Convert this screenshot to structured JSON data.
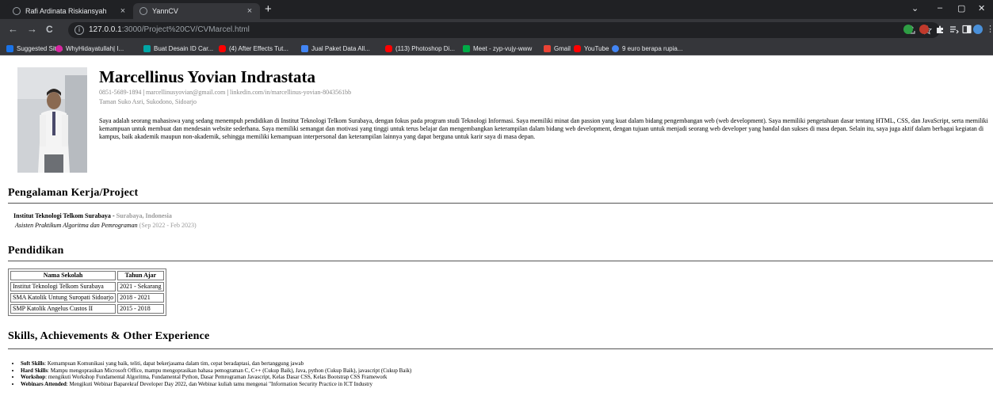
{
  "browser": {
    "tabs": [
      {
        "title": "Rafi Ardinata Riskiansyah",
        "close": "×"
      },
      {
        "title": "YannCV",
        "close": "×"
      }
    ],
    "new_tab": "+",
    "window_controls": {
      "collapse": "⌄",
      "minimize": "–",
      "maximize": "▢",
      "close": "✕"
    },
    "nav": {
      "back": "←",
      "forward": "→",
      "reload": "C"
    },
    "url_host": "127.0.0.1",
    "url_rest": ":3000/Project%20CV/CVMarcel.html",
    "info_icon": "i",
    "bookmarks": [
      {
        "label": "Suggested Sites",
        "icon": "bookmark-suggested-icon",
        "color": "#1a73e8"
      },
      {
        "label": "WhyHidayatullah| I...",
        "icon": "instagram-icon",
        "color": "#d6249f"
      },
      {
        "label": "Buat Desain ID Car...",
        "icon": "design-icon",
        "color": "#00a6a6"
      },
      {
        "label": "(4) After Effects Tut...",
        "icon": "youtube-icon",
        "color": "#ff0000"
      },
      {
        "label": "Jual Paket Data All...",
        "icon": "shop-icon",
        "color": "#4285f4"
      },
      {
        "label": "(113) Photoshop Di...",
        "icon": "youtube-icon",
        "color": "#ff0000"
      },
      {
        "label": "Meet - zyp-vujy-www",
        "icon": "meet-icon",
        "color": "#00ac47"
      },
      {
        "label": "Gmail",
        "icon": "gmail-icon",
        "color": "#ea4335"
      },
      {
        "label": "YouTube",
        "icon": "youtube-icon",
        "color": "#ff0000"
      },
      {
        "label": "9 euro berapa rupia...",
        "icon": "google-icon",
        "color": "#4285f4"
      }
    ]
  },
  "profile": {
    "name": "Marcellinus Yovian Indrastata",
    "phone": "0851-5689-1894",
    "email": "marcellinusyovian@gmail.com",
    "linkedin": "linkedin.com/in/marcellinus-yovian-8043561bb",
    "separator": "|",
    "address": "Taman Suko Asri, Sukodono, Sidoarjo",
    "about": "Saya adalah seorang mahasiswa yang sedang menempuh pendidikan di Institut Teknologi Telkom Surabaya, dengan fokus pada program studi Teknologi Informasi. Saya memiliki minat dan passion yang kuat dalam bidang pengembangan web (web development). Saya memiliki pengetahuan dasar tentang HTML, CSS, dan JavaScript, serta memiliki kemampuan untuk membuat dan mendesain website sederhana. Saya memiliki semangat dan motivasi yang tinggi untuk terus belajar dan mengembangkan keterampilan dalam bidang web development, dengan tujuan untuk menjadi seorang web developer yang handal dan sukses di masa depan. Selain itu, saya juga aktif dalam berbagai kegiatan di kampus, baik akademik maupun non-akademik, sehingga memiliki kemampuan interpersonal dan keterampilan lainnya yang dapat berguna untuk karir saya di masa depan."
  },
  "experience": {
    "heading": "Pengalaman Kerja/Project",
    "org": "Institut Teknologi Telkom Surabaya",
    "dash": " - ",
    "location": "Surabaya, Indonesia",
    "role": "Asisten Praktikum Algoritma dan Pemrograman",
    "period": "(Sep 2022 - Feb 2023)"
  },
  "education": {
    "heading": "Pendidikan",
    "columns": [
      "Nama Sekolah",
      "Tahun Ajar"
    ],
    "rows": [
      [
        "Institut Teknologi Telkom Surabaya",
        "2021 - Sekarang"
      ],
      [
        "SMA Katolik Untung Suropati Sidoarjo",
        "2018 - 2021"
      ],
      [
        "SMP Katolik Angelus Custos II",
        "2015 - 2018"
      ]
    ]
  },
  "skills": {
    "heading": "Skills, Achievements & Other Experience",
    "items": [
      {
        "label": "Soft Skills",
        "text": ": Kemampuan Komunikasi yang baik, teliti, dapat bekerjasama dalam tim, cepat beradaptasi, dan bertanggung jawab"
      },
      {
        "label": "Hard Skills",
        "text": ": Mampu mengoprasikan Microsoft Office, mampu mengoprasikan bahasa pemograman C, C++ (Cukup Baik), Java, python (Cukup Baik), javascript (Cukup Baik)"
      },
      {
        "label": "Workshop",
        "text": ": mengikuti Workshop Fundamental Algoritma, Fundamental Python, Dasar Pemrograman Javascript, Kelas Dasar CSS, Kelas Bootstrap CSS Framework"
      },
      {
        "label": "Webinars Attended",
        "text": ": Mengikuti Webinar Baparekraf Developer Day 2022, dan Webinar kuliah tamu mengenai \"Information Security Practice in ICT Industry"
      }
    ]
  }
}
